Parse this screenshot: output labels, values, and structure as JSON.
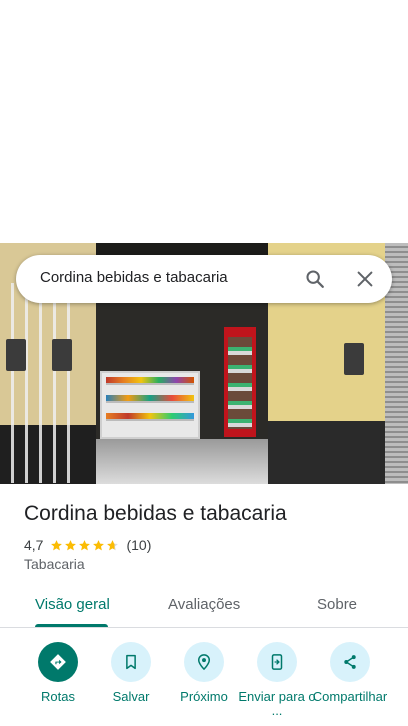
{
  "search": {
    "query": "Cordina bebidas e tabacaria"
  },
  "place": {
    "name": "Cordina bebidas e tabacaria",
    "rating": "4,7",
    "rating_fraction": 0.94,
    "review_count": "(10)",
    "category": "Tabacaria"
  },
  "tabs": [
    {
      "label": "Visão geral",
      "active": true
    },
    {
      "label": "Avaliações",
      "active": false
    },
    {
      "label": "Sobre",
      "active": false
    }
  ],
  "actions": [
    {
      "label": "Rotas",
      "icon": "directions-icon"
    },
    {
      "label": "Salvar",
      "icon": "bookmark-icon"
    },
    {
      "label": "Próximo",
      "icon": "nearby-icon"
    },
    {
      "label": "Enviar para o ...",
      "icon": "send-to-phone-icon"
    },
    {
      "label": "Compartilhar",
      "icon": "share-icon"
    }
  ],
  "colors": {
    "accent": "#00796b",
    "action_bg": "#d8f2fb",
    "star": "#fbbc04"
  }
}
